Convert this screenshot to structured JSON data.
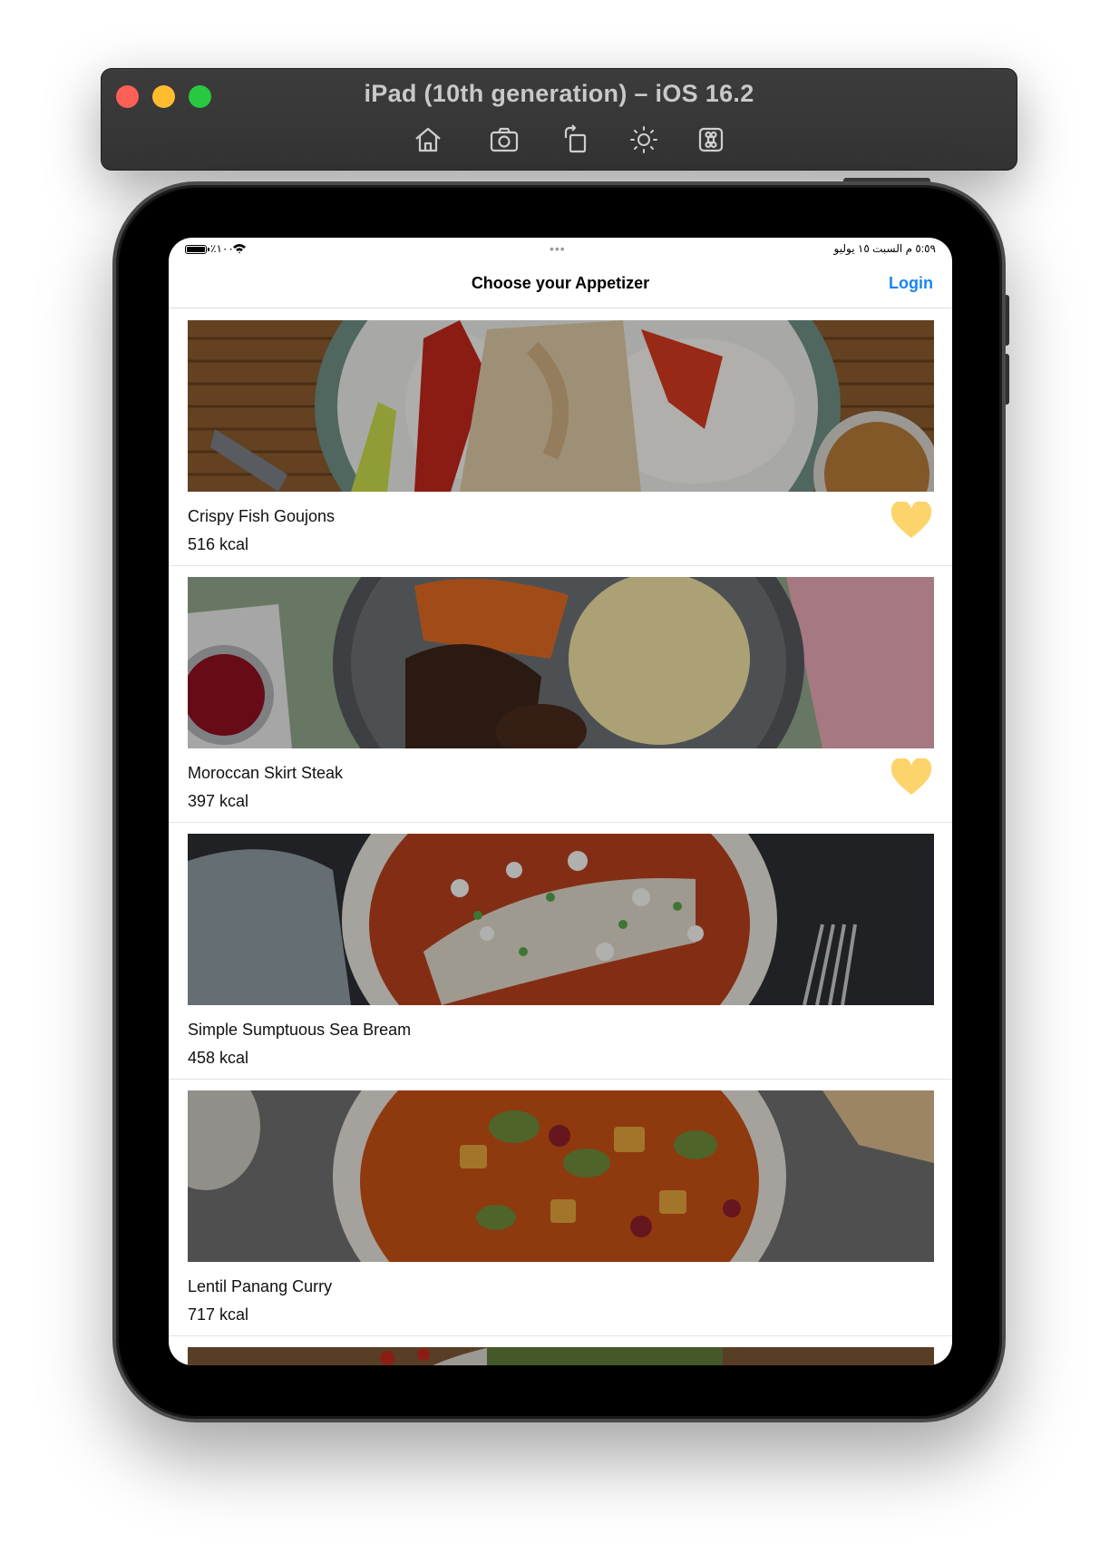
{
  "simulator": {
    "title": "iPad (10th generation) – iOS 16.2",
    "toolbar": [
      {
        "icon": "home-icon"
      },
      {
        "icon": "screenshot-icon"
      },
      {
        "icon": "rotate-icon"
      },
      {
        "icon": "brightness-icon"
      },
      {
        "icon": "command-icon"
      }
    ]
  },
  "status_bar": {
    "battery": "٪١٠٠",
    "time_date": "٥:٥٩ م   السبت ١٥ يوليو",
    "multitask_dots": "•••"
  },
  "nav": {
    "title": "Choose your Appetizer",
    "login_label": "Login"
  },
  "colors": {
    "accent": "#1a84f5",
    "favorite": "#fdd36b"
  },
  "items": [
    {
      "name": "Crispy Fish Goujons",
      "kcal": "516 kcal",
      "favorite": true
    },
    {
      "name": "Moroccan Skirt Steak",
      "kcal": "397 kcal",
      "favorite": true
    },
    {
      "name": "Simple Sumptuous Sea Bream",
      "kcal": "458 kcal",
      "favorite": false
    },
    {
      "name": "Lentil Panang Curry",
      "kcal": "717 kcal",
      "favorite": false
    }
  ]
}
